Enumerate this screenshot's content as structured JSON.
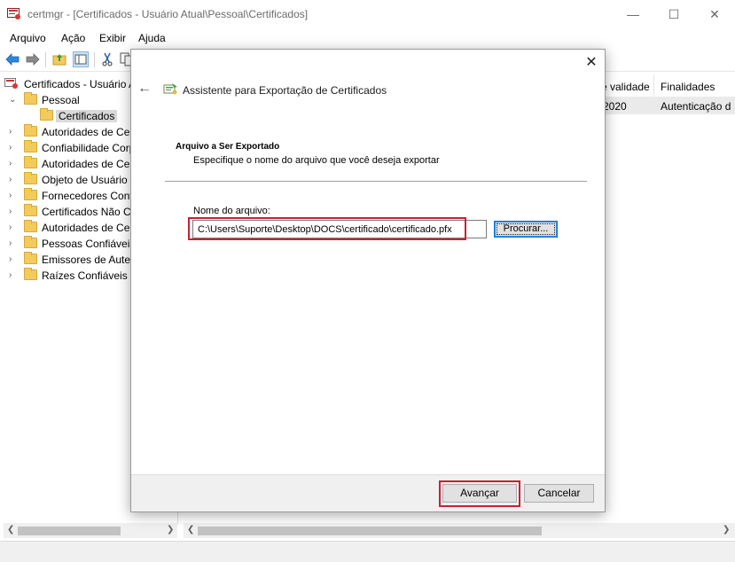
{
  "window": {
    "title": "certmgr - [Certificados - Usuário Atual\\Pessoal\\Certificados]",
    "minimize_glyph": "—",
    "maximize_glyph": "☐",
    "close_glyph": "✕"
  },
  "menu": {
    "items": [
      "Arquivo",
      "Ação",
      "Exibir",
      "Ajuda"
    ]
  },
  "toolbar": {
    "icons": [
      "back-arrow-icon",
      "forward-arrow-icon",
      "folder-up-icon",
      "show-hide-tree-icon",
      "cut-icon",
      "copy-icon"
    ]
  },
  "tree": {
    "root": "Certificados - Usuário A",
    "pessoal": "Pessoal",
    "certificados": "Certificados",
    "items": [
      "Autoridades de Cert",
      "Confiabilidade Corp",
      "Autoridades de Cer",
      "Objeto de Usuário d",
      "Fornecedores Confi",
      "Certificados Não Co",
      "Autoridades de Cer",
      "Pessoas Confiáveis",
      "Emissores de Auten",
      "Raízes Confiáveis d"
    ]
  },
  "list": {
    "headers": [
      "e validade",
      "Finalidades"
    ],
    "rows": [
      [
        "2020",
        "Autenticação d"
      ]
    ]
  },
  "dialog": {
    "close_glyph": "✕",
    "back_glyph": "←",
    "title": "Assistente para Exportação de Certificados",
    "section_title": "Arquivo a Ser Exportado",
    "section_desc": "Especifique o nome do arquivo que você deseja exportar",
    "file_label": "Nome do arquivo:",
    "file_value": "C:\\Users\\Suporte\\Desktop\\DOCS\\certificado\\certificado.pfx",
    "browse_label": "Procurar...",
    "next_label": "Avançar",
    "cancel_label": "Cancelar"
  },
  "colors": {
    "highlight_red": "#cc1f33",
    "focus_blue": "#0078d7",
    "folder_yellow": "#f3cb5c"
  }
}
